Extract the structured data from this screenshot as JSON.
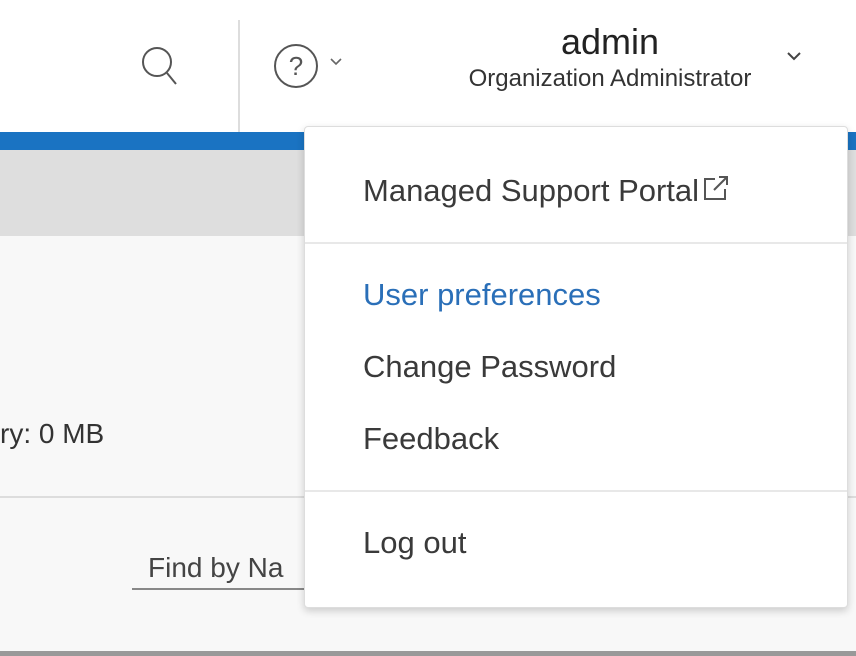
{
  "header": {
    "user_name": "admin",
    "user_role": "Organization Administrator"
  },
  "content": {
    "memory_text": "ry:  0 MB",
    "find_placeholder": "Find by Na"
  },
  "menu": {
    "items": [
      {
        "label": "Managed Support Portal",
        "external": true
      },
      {
        "label": "User preferences",
        "highlighted": true
      },
      {
        "label": "Change Password"
      },
      {
        "label": "Feedback"
      },
      {
        "label": "Log out"
      }
    ]
  },
  "colors": {
    "accent": "#1a73c2",
    "highlight_text": "#2a6fb8"
  }
}
